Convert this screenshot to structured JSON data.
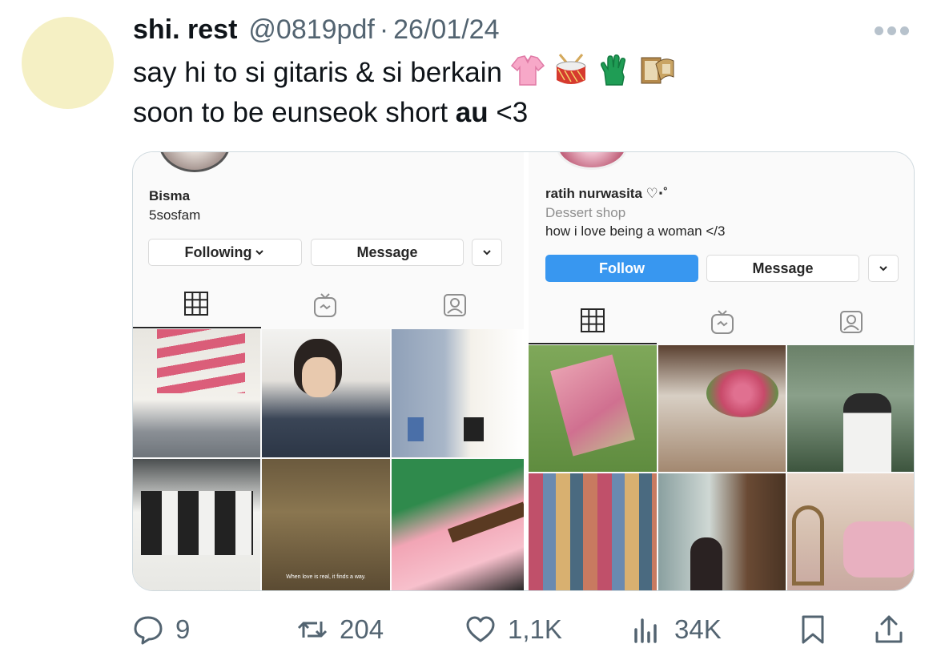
{
  "tweet": {
    "display_name": "shi. rest",
    "handle": "@0819pdf",
    "separator": "·",
    "date": "26/01/24",
    "line1": "say hi to si gitaris & si berkain",
    "line2_prefix": "soon to be eunseok short ",
    "line2_bold": "au",
    "line2_suffix": " <3",
    "emojis": [
      "blouse-emoji",
      "drum-emoji",
      "glove-emoji",
      "film-frames-emoji"
    ]
  },
  "profiles": {
    "left": {
      "name": "Bisma",
      "bio": "5sosfam",
      "following_label": "Following",
      "message_label": "Message"
    },
    "right": {
      "name": "ratih nurwasita ♡⋅˚",
      "category": "Dessert shop",
      "bio": "how i love being a woman </3",
      "follow_label": "Follow",
      "message_label": "Message"
    },
    "grid_caption": "When love is real, it finds a way."
  },
  "stats": {
    "replies": "9",
    "retweets": "204",
    "likes": "1,1K",
    "views": "34K"
  },
  "colors": {
    "text": "#0f1419",
    "muted": "#536471",
    "avatar": "#f5f0c4",
    "ig_blue": "#3897f0"
  }
}
